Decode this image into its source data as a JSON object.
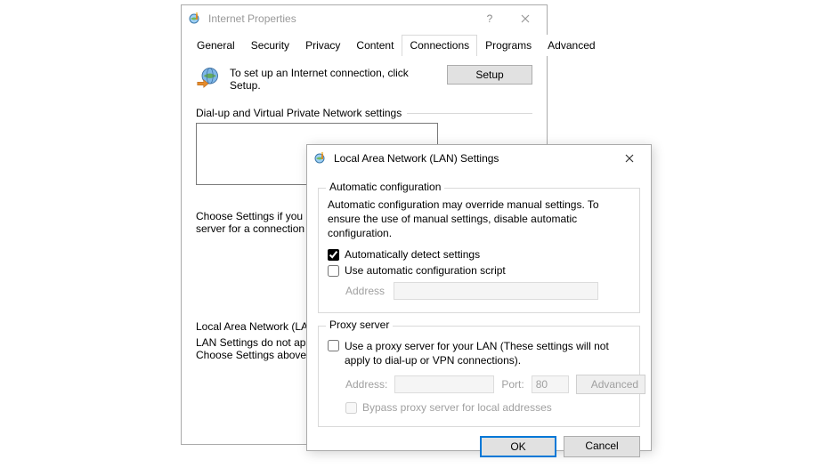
{
  "parent": {
    "title": "Internet Properties",
    "tabs": [
      "General",
      "Security",
      "Privacy",
      "Content",
      "Connections",
      "Programs",
      "Advanced"
    ],
    "active_tab": "Connections",
    "setup_text": "To set up an Internet connection, click Setup.",
    "setup_button": "Setup",
    "dialup_label": "Dial-up and Virtual Private Network settings",
    "choose_text_line1": "Choose Settings if you",
    "choose_text_line2": "server for a connection",
    "lan_header": "Local Area Network (LA",
    "lan_text_line1": "LAN Settings do not ap",
    "lan_text_line2": "Choose Settings above"
  },
  "lan": {
    "title": "Local Area Network (LAN) Settings",
    "auto": {
      "legend": "Automatic configuration",
      "desc": "Automatic configuration may override manual settings.  To ensure the use of manual settings, disable automatic configuration.",
      "chk_detect": "Automatically detect settings",
      "chk_script": "Use automatic configuration script",
      "address_label": "Address"
    },
    "proxy": {
      "legend": "Proxy server",
      "chk_use": "Use a proxy server for your LAN (These settings will not apply to dial-up or VPN connections).",
      "address_label": "Address:",
      "port_label": "Port:",
      "port_value": "80",
      "advanced": "Advanced",
      "bypass": "Bypass proxy server for local addresses"
    },
    "ok": "OK",
    "cancel": "Cancel"
  }
}
